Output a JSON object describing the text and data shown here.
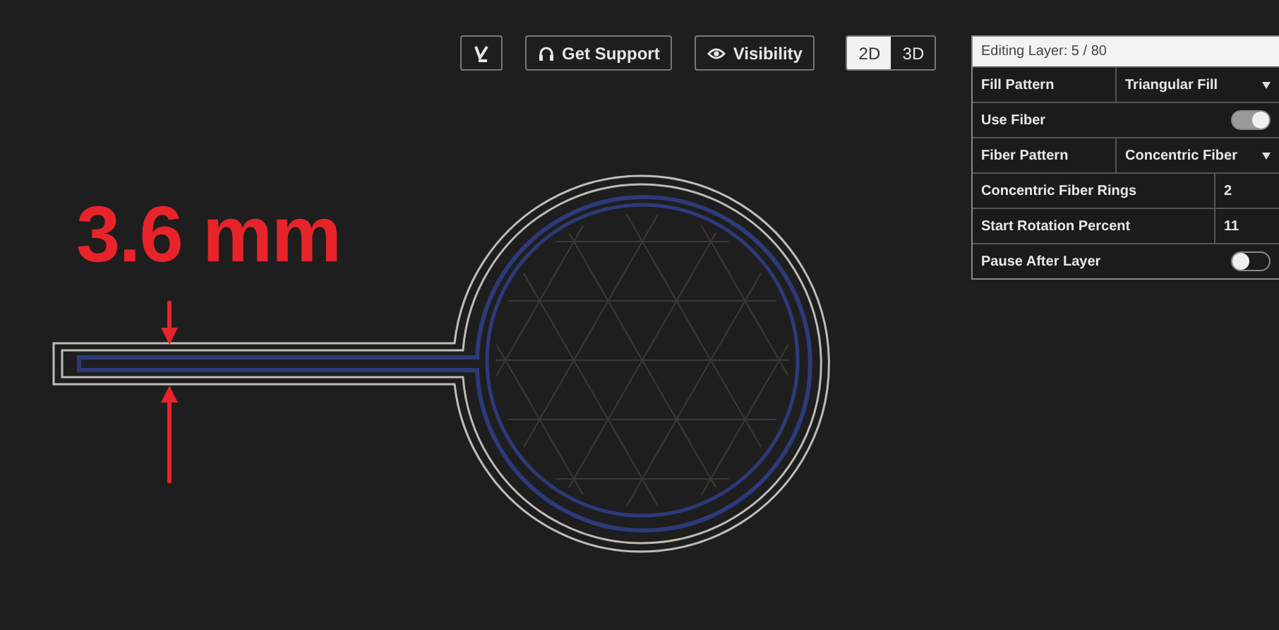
{
  "annotation": {
    "text": "3.6 mm"
  },
  "toolbar": {
    "buttons": [
      {
        "kind": "logo"
      },
      {
        "kind": "support",
        "label": "Get Support"
      },
      {
        "kind": "visibility",
        "label": "Visibility"
      }
    ],
    "view_modes": [
      {
        "label": "2D",
        "selected": true
      },
      {
        "label": "3D",
        "selected": false
      }
    ]
  },
  "panel": {
    "title": "Editing Layer: 5 / 80",
    "rows": [
      {
        "kind": "dropdown",
        "label": "Fill Pattern",
        "value": "Triangular Fill"
      },
      {
        "kind": "toggle",
        "label": "Use Fiber",
        "on": true
      },
      {
        "kind": "dropdown",
        "label": "Fiber Pattern",
        "value": "Concentric Fiber"
      },
      {
        "kind": "number",
        "label": "Concentric Fiber Rings",
        "value": "2"
      },
      {
        "kind": "number",
        "label": "Start Rotation Percent",
        "value": "11"
      },
      {
        "kind": "toggle",
        "label": "Pause After Layer",
        "on": false
      }
    ]
  }
}
